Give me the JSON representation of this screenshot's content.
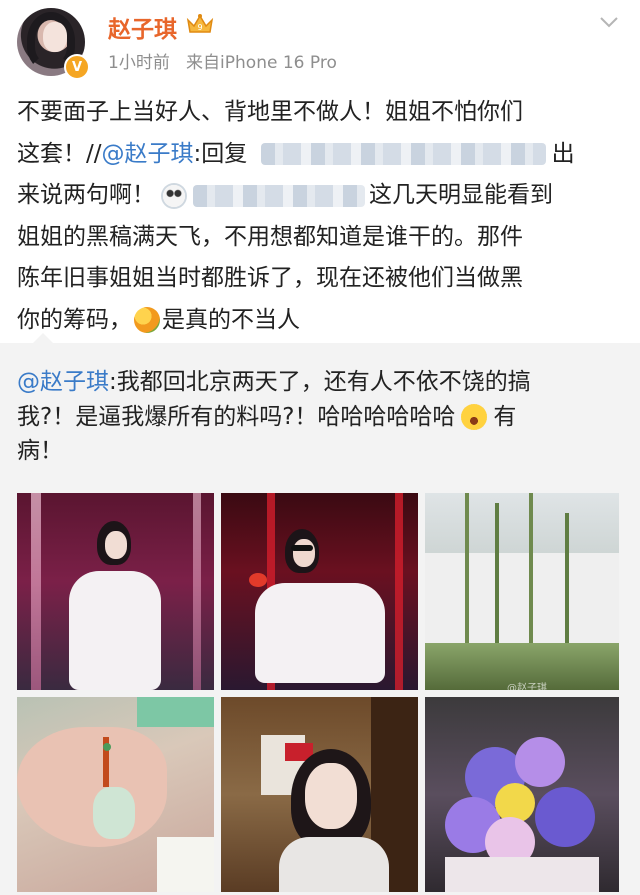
{
  "user": {
    "name": "赵子琪",
    "verified_mark": "V",
    "time": "1小时前",
    "source": "来自iPhone 16 Pro"
  },
  "post": {
    "line1": "不要面子上当好人、背地里不做人！姐姐不怕你们",
    "line2_a": "这套！//",
    "line2_mention": "@赵子琪",
    "line2_b": ":回复",
    "line2_c": "出",
    "line3_a": "来说两句啊！",
    "line3_b": "这几天明显能看到",
    "line4": "姐姐的黑稿满天飞，不用想都知道是谁干的。那件",
    "line5": "陈年旧事姐姐当时都胜诉了，现在还被他们当做黑",
    "line6_a": "你的筹码，",
    "line6_b": "是真的不当人"
  },
  "repost": {
    "mention": "@赵子琪",
    "line1_a": ":我都回北京两天了，还有人不依不饶的搞",
    "line2": "我?！是逼我爆所有的料吗?！哈哈哈哈哈哈",
    "line2_b": "有",
    "line3": "病！"
  },
  "images": {
    "watermark": "@赵子琪"
  },
  "colors": {
    "username": "#e8662b",
    "mention": "#3a7bc8",
    "repost_bg": "#f3f3f3"
  },
  "icons": [
    "crown-badge-icon",
    "verified-badge-icon",
    "chevron-down-icon",
    "ghost-emoji-icon",
    "mango-emoji-icon",
    "laugh-emoji-icon"
  ]
}
